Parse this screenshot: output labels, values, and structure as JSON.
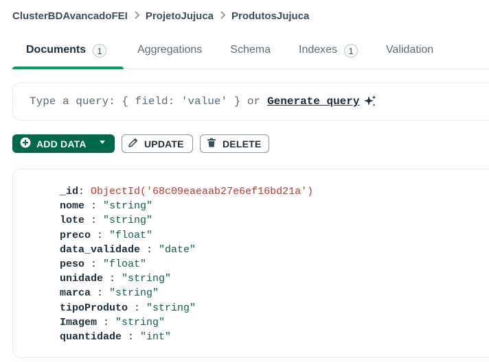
{
  "breadcrumb": {
    "cluster": "ClusterBDAvancadoFEI",
    "database": "ProjetoJujuca",
    "collection": "ProdutosJujuca"
  },
  "tabs": [
    {
      "label": "Documents",
      "count": "1",
      "active": true
    },
    {
      "label": "Aggregations"
    },
    {
      "label": "Schema"
    },
    {
      "label": "Indexes",
      "count": "1"
    },
    {
      "label": "Validation"
    }
  ],
  "query": {
    "placeholder": "Type a query: { field: 'value' } or",
    "generate_label": "Generate query",
    "generate_icon": "sparkle-icon"
  },
  "toolbar": {
    "add_label": "ADD DATA",
    "update_label": "UPDATE",
    "delete_label": "DELETE"
  },
  "document": {
    "fields": [
      {
        "key": "_id",
        "value": "ObjectId('68c09eaeaab27e6ef16bd21a')"
      },
      {
        "key": "nome",
        "value": "\"string\""
      },
      {
        "key": "lote",
        "value": "\"string\""
      },
      {
        "key": "preco",
        "value": "\"float\""
      },
      {
        "key": "data_validade",
        "value": "\"date\""
      },
      {
        "key": "peso",
        "value": "\"float\""
      },
      {
        "key": "unidade",
        "value": "\"string\""
      },
      {
        "key": "marca",
        "value": "\"string\""
      },
      {
        "key": "tipoProduto",
        "value": "\"string\""
      },
      {
        "key": "Imagem",
        "value": "\"string\""
      },
      {
        "key": "quantidade",
        "value": "\"int\""
      }
    ]
  },
  "colors": {
    "accent": "#00a35c",
    "primary_button": "#00684a",
    "object_id": "#c0392b",
    "string_value": "#116149"
  }
}
